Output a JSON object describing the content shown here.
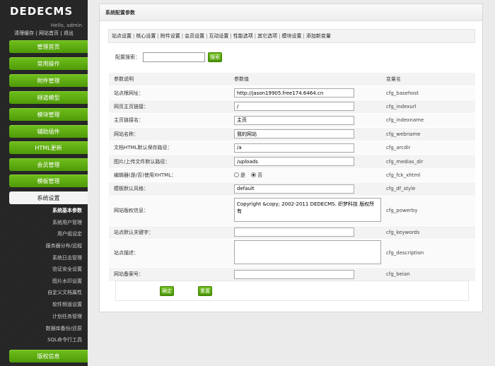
{
  "sidebar": {
    "logo": "DEDECMS",
    "hello": "Hello, admin",
    "links": [
      "清理缓存",
      "网站首页",
      "退出"
    ],
    "link_sep": "|",
    "nav": [
      "管理首页",
      "常用操作",
      "附件管理",
      "频道模型",
      "模块管理",
      "辅助插件",
      "HTML更新",
      "会员管理",
      "模板管理",
      "系统设置"
    ],
    "sub_items": [
      "系统基本参数",
      "系统用户管理",
      "用户组设定",
      "服务器分布/远程",
      "系统日志管理",
      "验证安全设置",
      "图片水印设置",
      "自定义文档属性",
      "软件频道设置",
      "计划任务管理",
      "数据库备份/还原",
      "SQL命令行工具"
    ],
    "bottom_nav": "版权信息"
  },
  "panel": {
    "title": "系统配置参数",
    "tabs": [
      "站点设置",
      "核心设置",
      "附件设置",
      "会员设置",
      "互动设置",
      "性能选项",
      "其它选项",
      "模块设置",
      "添加新变量"
    ],
    "tab_sep": "|",
    "search_label": "配置搜索：",
    "search_value": "",
    "search_button": "搜索"
  },
  "table": {
    "headers": [
      "参数说明",
      "参数值",
      "变量名"
    ],
    "rows": [
      {
        "label": "站点根网址：",
        "value": "http://jason19905.free174.6464.cn",
        "var": "cfg_basehost"
      },
      {
        "label": "网页主页链接：",
        "value": "/",
        "var": "cfg_indexurl"
      },
      {
        "label": "主页链接名：",
        "value": "主页",
        "var": "cfg_indexname"
      },
      {
        "label": "网站名称：",
        "value": "我的网站",
        "var": "cfg_webname"
      },
      {
        "label": "文档HTML默认保存路径：",
        "value": "/a",
        "var": "cfg_arcdir"
      },
      {
        "label": "图片/上传文件默认路径：",
        "value": "/uploads",
        "var": "cfg_medias_dir"
      },
      {
        "label": "编辑器(是/否)使用XHTML：",
        "radio_yes": "是",
        "radio_no": "否",
        "var": "cfg_fck_xhtml"
      },
      {
        "label": "模板默认风格：",
        "value": "default",
        "var": "cfg_df_style"
      },
      {
        "label": "网站版权信息：",
        "value": "Copyright &copy; 2002-2011 DEDECMS. 织梦科技 版权所有",
        "var": "cfg_powerby"
      },
      {
        "label": "站点默认关键字：",
        "value": "",
        "var": "cfg_keywords"
      },
      {
        "label": "站点描述：",
        "value": "",
        "var": "cfg_description"
      },
      {
        "label": "网站备案号：",
        "value": "",
        "var": "cfg_beian"
      }
    ]
  },
  "footer": {
    "ok_button": "确定",
    "reset_button": "重置"
  }
}
